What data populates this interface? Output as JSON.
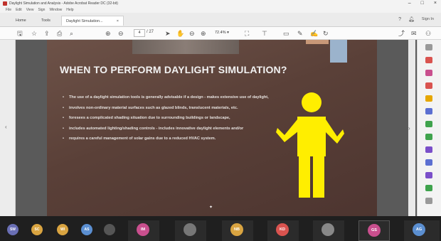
{
  "window": {
    "title": "Daylight Simulation and Analysis - Adobe Acrobat Reader DC (32-bit)",
    "controls": [
      "–",
      "□",
      "×"
    ]
  },
  "menu": [
    "File",
    "Edit",
    "View",
    "Sign",
    "Window",
    "Help"
  ],
  "tabs": {
    "home": "Home",
    "tools": "Tools",
    "document": "Daylight Simulation...",
    "close": "×",
    "sign_in": "Sign In"
  },
  "toolbar": {
    "page_current": "4",
    "page_total": "/ 27",
    "zoom": "72.4%"
  },
  "slide": {
    "title": "WHEN TO PERFORM DAYLIGHT SIMULATION?",
    "bullets": [
      "The use of a daylight simulation tools is generally advisable if a design - makes extensive use of daylight,",
      "involves non-ordinary material surfaces such as glazed blinds, translucent materials, etc.",
      "foresees a complicated shading situation due to surrounding buildings or landscape,",
      "includes automated lighting/shading controls - includes innovative daylight elements and/or",
      "requires a careful management of solar gains due to a reduced HVAC system."
    ],
    "figure_color": "#ffee00"
  },
  "colors": {
    "slide_bg": "#5a4038",
    "accent_yellow": "#ffee00",
    "acrobat_red": "#c0322c"
  },
  "participants_small": [
    {
      "initials": "SW",
      "color": "#6a6fb5"
    },
    {
      "initials": "SC",
      "color": "#d9a441"
    },
    {
      "initials": "WI",
      "color": "#d9a441"
    },
    {
      "initials": "AS",
      "color": "#5b8fd1"
    },
    {
      "initials": "",
      "color": "#555555"
    }
  ],
  "participants": [
    {
      "initials": "IM",
      "color": "#c94f8e"
    },
    {
      "initials": "",
      "color": "#777777"
    },
    {
      "initials": "NB",
      "color": "#d9a441"
    },
    {
      "initials": "KD",
      "color": "#d9534f"
    },
    {
      "initials": "",
      "color": "#888888"
    },
    {
      "initials": "GS",
      "color": "#c94f8e"
    },
    {
      "initials": "AG",
      "color": "#5b8fd1"
    }
  ]
}
